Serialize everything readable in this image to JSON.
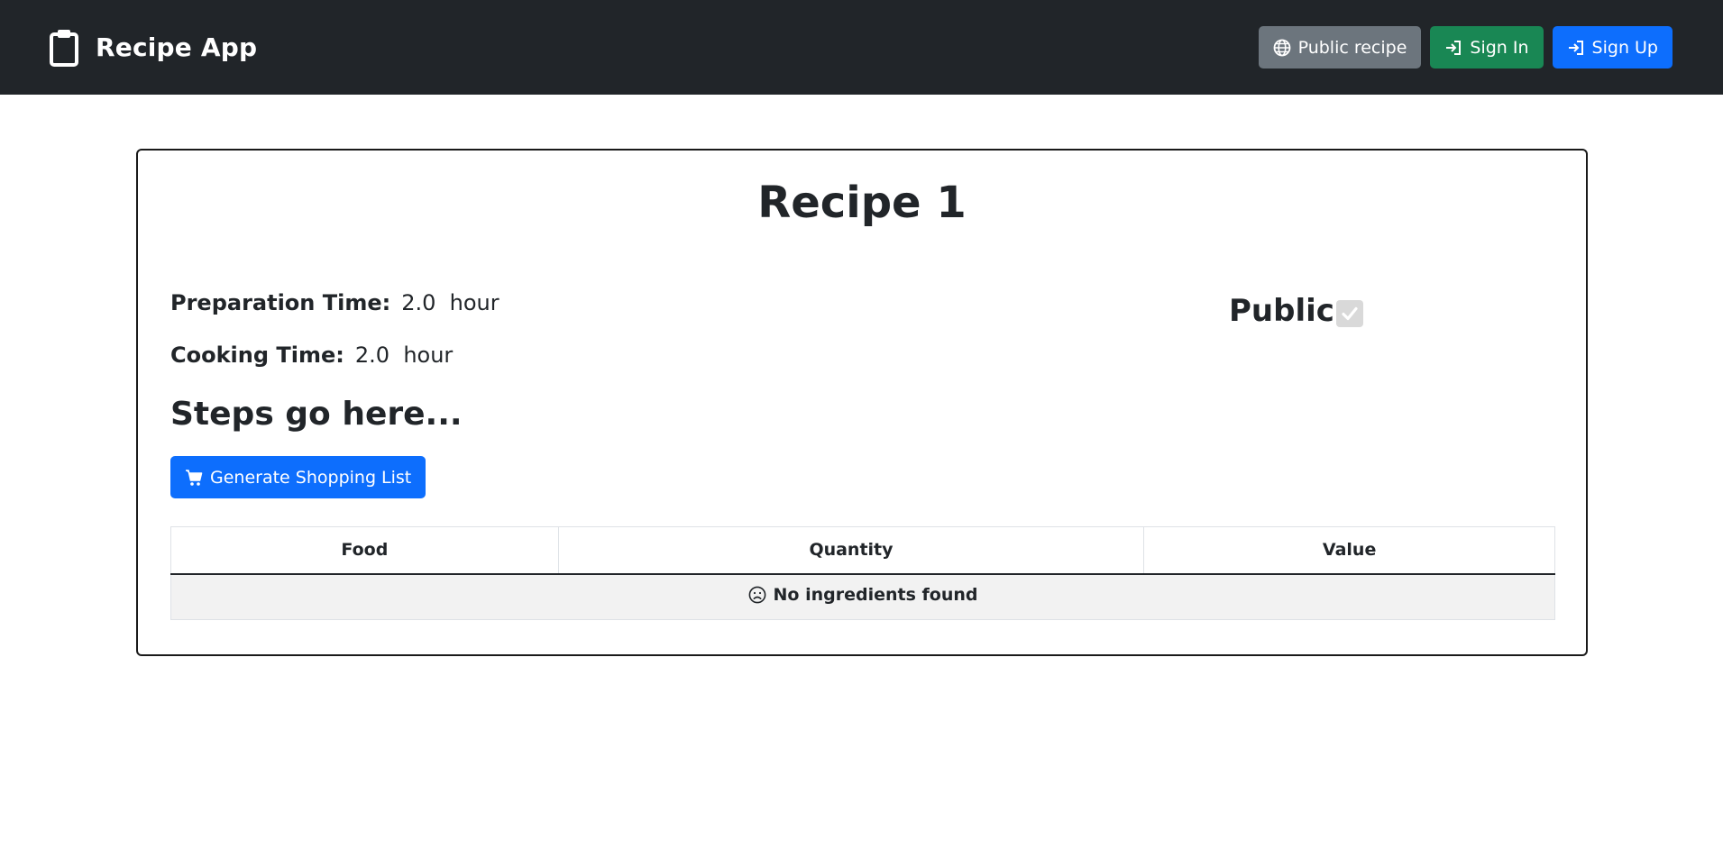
{
  "navbar": {
    "brand_icon": "clipboard-icon",
    "brand_title": "Recipe App",
    "buttons": [
      {
        "label": "Public recipe",
        "icon": "globe-icon",
        "color": "#6c757d"
      },
      {
        "label": "Sign In",
        "icon": "sign-in-icon",
        "color": "#198754"
      },
      {
        "label": "Sign Up",
        "icon": "sign-in-icon",
        "color": "#0d6efd"
      }
    ]
  },
  "recipe": {
    "title": "Recipe 1",
    "preparation_label": "Preparation Time:",
    "preparation_value": "2.0  hour",
    "cooking_label": "Cooking Time:",
    "cooking_value": "2.0  hour",
    "public_label": "Public",
    "public_checked": true,
    "steps_heading": "Steps go here...",
    "shopping_button": {
      "label": "Generate Shopping List",
      "icon": "cart-icon",
      "color": "#0d6efd"
    }
  },
  "ingredients_table": {
    "columns": [
      "Food",
      "Quantity",
      "Value"
    ],
    "empty_message": "No ingredients found",
    "empty_icon": "frown-icon"
  }
}
